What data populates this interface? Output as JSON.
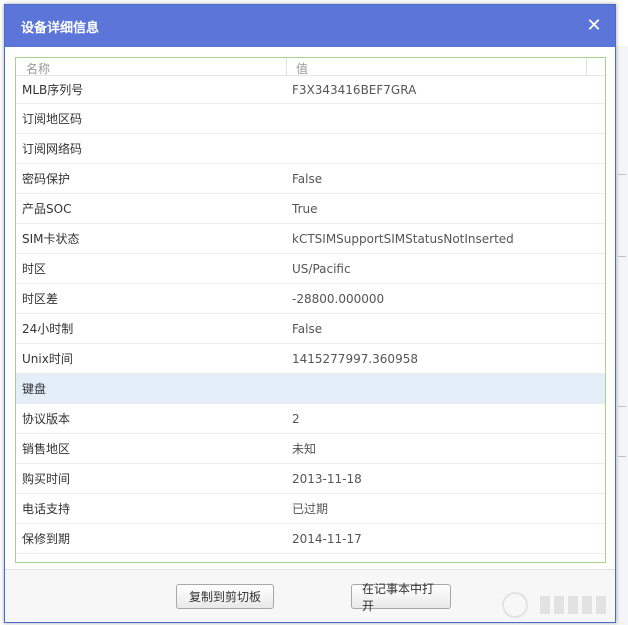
{
  "dialog": {
    "title": "设备详细信息",
    "close_glyph": "✕"
  },
  "table": {
    "headers": {
      "name": "名称",
      "value": "值"
    },
    "rows": [
      {
        "name": "MLB序列号",
        "value": "F3X343416BEF7GRA"
      },
      {
        "name": "订阅地区码",
        "value": ""
      },
      {
        "name": "订阅网络码",
        "value": ""
      },
      {
        "name": "密码保护",
        "value": "False"
      },
      {
        "name": "产品SOC",
        "value": "True"
      },
      {
        "name": "SIM卡状态",
        "value": "kCTSIMSupportSIMStatusNotInserted"
      },
      {
        "name": "时区",
        "value": "US/Pacific"
      },
      {
        "name": "时区差",
        "value": "-28800.000000"
      },
      {
        "name": "24小时制",
        "value": "False"
      },
      {
        "name": "Unix时间",
        "value": "1415277997.360958"
      },
      {
        "name": "键盘",
        "value": ""
      },
      {
        "name": "协议版本",
        "value": "2"
      },
      {
        "name": "销售地区",
        "value": "未知"
      },
      {
        "name": "购买时间",
        "value": "2013-11-18"
      },
      {
        "name": "电话支持",
        "value": "已过期"
      },
      {
        "name": "保修到期",
        "value": "2014-11-17"
      }
    ],
    "selected_row": "键盘"
  },
  "footer": {
    "copy_label": "复制到剪切板",
    "open_label": "在记事本中打开"
  },
  "colors": {
    "titlebar": "#5b76d8",
    "selected_row": "#e3eef9",
    "content_border": "#a9d18e"
  }
}
